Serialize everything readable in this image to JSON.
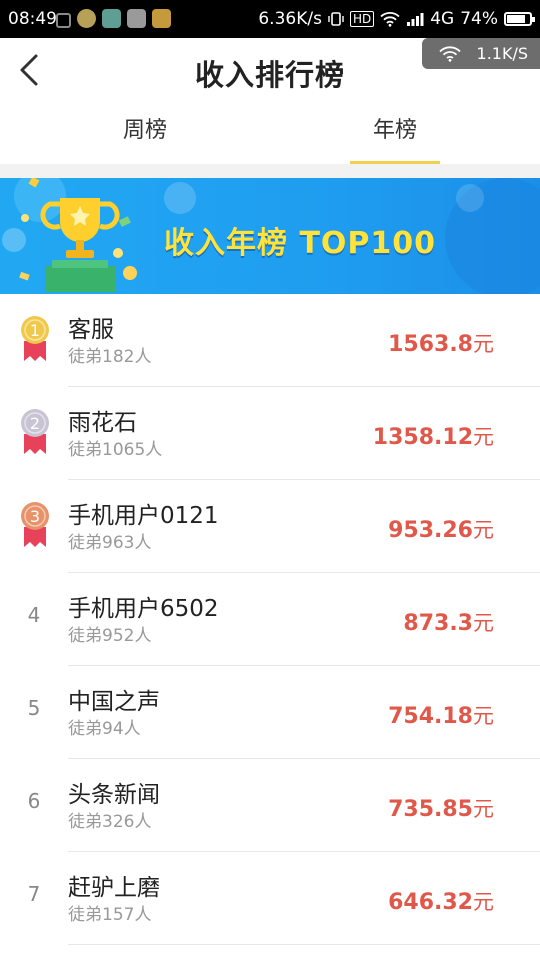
{
  "status_bar": {
    "time": "08:49",
    "net_speed": "6.36K/s",
    "hd_label": "HD",
    "network": "4G",
    "battery": "74%",
    "battery_level": 0.74
  },
  "network_overlay": {
    "speed": "1.1K/S"
  },
  "header": {
    "title": "收入排行榜",
    "back_icon": "chevron-left-icon"
  },
  "tabs": [
    {
      "label": "周榜",
      "active": false
    },
    {
      "label": "年榜",
      "active": true
    }
  ],
  "banner": {
    "title": "收入年榜 TOP100",
    "icon": "trophy-icon"
  },
  "ranking": {
    "currency_unit": "元",
    "items": [
      {
        "rank": "1",
        "medal": "gold",
        "name": "客服",
        "disciples": "徒弟182人",
        "amount": "1563.8"
      },
      {
        "rank": "2",
        "medal": "silver",
        "name": "雨花石",
        "disciples": "徒弟1065人",
        "amount": "1358.12"
      },
      {
        "rank": "3",
        "medal": "bronze",
        "name": "手机用户0121",
        "disciples": "徒弟963人",
        "amount": "953.26"
      },
      {
        "rank": "4",
        "medal": "",
        "name": "手机用户6502",
        "disciples": "徒弟952人",
        "amount": "873.3"
      },
      {
        "rank": "5",
        "medal": "",
        "name": "中国之声",
        "disciples": "徒弟94人",
        "amount": "754.18"
      },
      {
        "rank": "6",
        "medal": "",
        "name": "头条新闻",
        "disciples": "徒弟326人",
        "amount": "735.85"
      },
      {
        "rank": "7",
        "medal": "",
        "name": "赶驴上磨",
        "disciples": "徒弟157人",
        "amount": "646.32"
      }
    ]
  },
  "colors": {
    "accent_underline": "#f2d04f",
    "amount": "#e0584a",
    "banner_blue": "#22a8f3",
    "banner_text": "#ffe23a",
    "gold": "#f1c94a",
    "silver": "#c9c4d4",
    "bronze": "#e8926a",
    "ribbon": "#e8415a"
  }
}
